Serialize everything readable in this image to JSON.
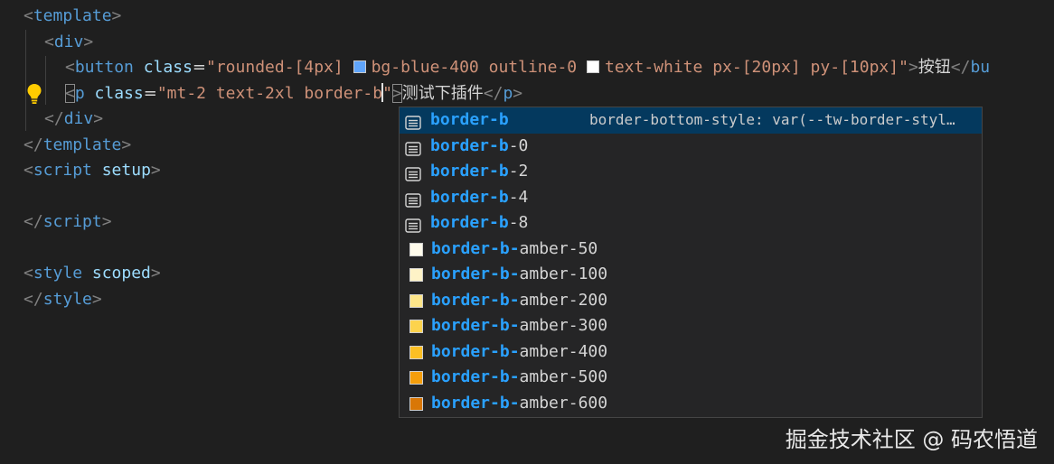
{
  "editor": {
    "lines": {
      "l1": {
        "open": "<",
        "tag": "template",
        "close": ">"
      },
      "l2": {
        "open": "<",
        "tag": "div",
        "close": ">"
      },
      "l3": {
        "open": "<",
        "tag": "button",
        "attr": "class",
        "eq": "=",
        "q1": "\"",
        "v1": "rounded-[4px] ",
        "v2": "bg-blue-400 outline-0 ",
        "v3": "text-white px-[20px] py-[10px]",
        "q2": "\"",
        "close": ">",
        "text": "按钮",
        "end_open": "</",
        "end_tag": "bu"
      },
      "l4": {
        "open": "<",
        "tag": "p",
        "attr": "class",
        "eq": "=",
        "q1": "\"",
        "value": "mt-2 text-2xl border-b",
        "q2": "\"",
        "close": ">",
        "text": "测试下插件",
        "end_open": "</",
        "end_tag": "p",
        "end_close": ">"
      },
      "l5": {
        "open": "</",
        "tag": "div",
        "close": ">"
      },
      "l6": {
        "open": "</",
        "tag": "template",
        "close": ">"
      },
      "l7": {
        "open": "<",
        "tag": "script",
        "attr": "setup",
        "close": ">"
      },
      "l9": {
        "open": "</",
        "tag": "script",
        "close": ">"
      },
      "l11": {
        "open": "<",
        "tag": "style",
        "attr": "scoped",
        "close": ">"
      },
      "l12": {
        "open": "</",
        "tag": "style",
        "close": ">"
      }
    },
    "swatch_colors": {
      "blue_400": "#60a5fa",
      "white": "#ffffff"
    }
  },
  "suggestions": {
    "match_prefix": "border-b",
    "items": [
      {
        "match": "border-b",
        "rest": "",
        "kind": "text-icon",
        "selected": true,
        "detail": "border-bottom-style: var(--tw-border-styl…"
      },
      {
        "match": "border-b",
        "rest": "-0",
        "kind": "text-icon"
      },
      {
        "match": "border-b",
        "rest": "-2",
        "kind": "text-icon"
      },
      {
        "match": "border-b",
        "rest": "-4",
        "kind": "text-icon"
      },
      {
        "match": "border-b",
        "rest": "-8",
        "kind": "text-icon"
      },
      {
        "match": "border-b-",
        "rest": "amber-50",
        "kind": "color",
        "color": "#fffbeb"
      },
      {
        "match": "border-b-",
        "rest": "amber-100",
        "kind": "color",
        "color": "#fef3c7"
      },
      {
        "match": "border-b-",
        "rest": "amber-200",
        "kind": "color",
        "color": "#fde68a"
      },
      {
        "match": "border-b-",
        "rest": "amber-300",
        "kind": "color",
        "color": "#fcd34d"
      },
      {
        "match": "border-b-",
        "rest": "amber-400",
        "kind": "color",
        "color": "#fbbf24"
      },
      {
        "match": "border-b-",
        "rest": "amber-500",
        "kind": "color",
        "color": "#f59e0b"
      },
      {
        "match": "border-b-",
        "rest": "amber-600",
        "kind": "color",
        "color": "#d97706"
      }
    ]
  },
  "watermark": "掘金技术社区 @ 码农悟道"
}
